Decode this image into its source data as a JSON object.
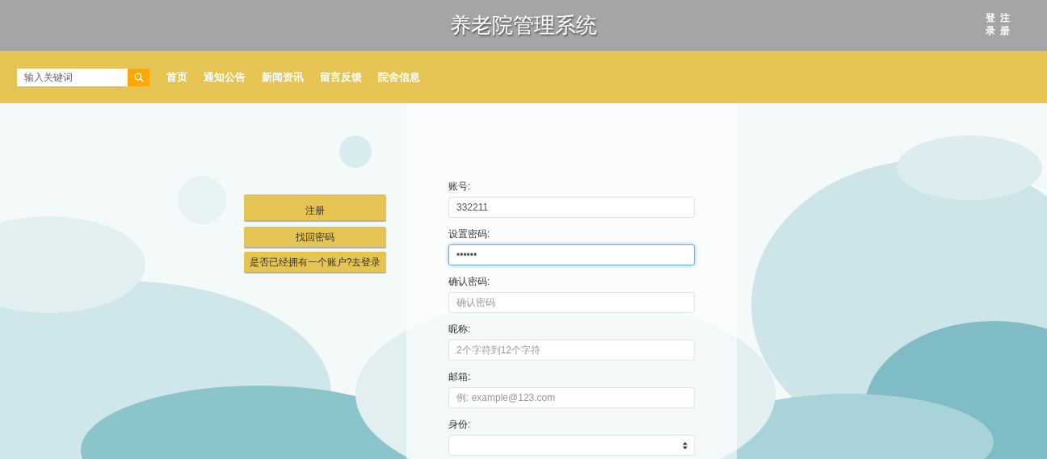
{
  "header": {
    "title": "养老院管理系统",
    "links": [
      "登录",
      "注册"
    ]
  },
  "nav": {
    "search": {
      "placeholder": "输入关键词"
    },
    "items": [
      "首页",
      "通知公告",
      "新闻资讯",
      "留言反馈",
      "院舍信息"
    ]
  },
  "side_buttons": [
    "注册",
    "找回密码",
    "是否已经拥有一个账户?去登录"
  ],
  "form": [
    {
      "label": "账号:",
      "kind": "input",
      "value": "332211",
      "focused": false
    },
    {
      "label": "设置密码:",
      "kind": "input",
      "value": "••••••",
      "focused": true
    },
    {
      "label": "确认密码:",
      "kind": "input",
      "placeholder": "确认密码",
      "focused": false
    },
    {
      "label": "昵称:",
      "kind": "input",
      "placeholder": "2个字符到12个字符",
      "focused": false
    },
    {
      "label": "邮箱:",
      "kind": "input",
      "placeholder": "例: example@123.com",
      "focused": false
    },
    {
      "label": "身份:",
      "kind": "select",
      "focused": false
    }
  ]
}
